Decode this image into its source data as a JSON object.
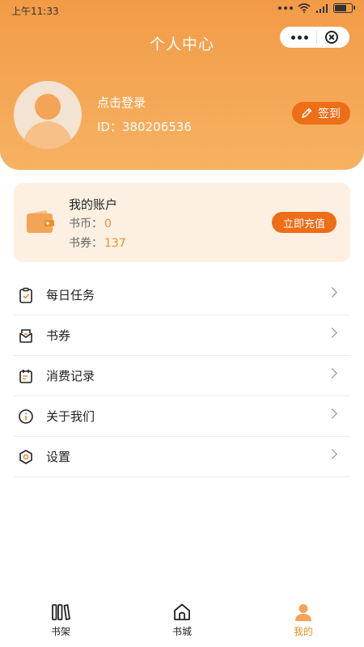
{
  "status": {
    "time": "上午11:33"
  },
  "header": {
    "title": "个人中心",
    "login_text": "点击登录",
    "user_id": "ID：380206536",
    "signin_label": "签到"
  },
  "account": {
    "title": "我的账户",
    "coins_label": "书币：",
    "coins_value": "0",
    "vouchers_label": "书券：",
    "vouchers_value": "137",
    "recharge_label": "立即充值"
  },
  "menu": {
    "items": [
      {
        "label": "每日任务",
        "icon": "clipboard-check-icon"
      },
      {
        "label": "书券",
        "icon": "ticket-icon"
      },
      {
        "label": "消费记录",
        "icon": "calendar-record-icon"
      },
      {
        "label": "关于我们",
        "icon": "info-icon"
      },
      {
        "label": "设置",
        "icon": "settings-icon"
      }
    ]
  },
  "nav": {
    "items": [
      {
        "label": "书架",
        "icon": "bookshelf-icon",
        "active": false
      },
      {
        "label": "书城",
        "icon": "home-icon",
        "active": false
      },
      {
        "label": "我的",
        "icon": "user-icon",
        "active": true
      }
    ]
  },
  "colors": {
    "accent": "#ee6d17",
    "header_top": "#f29b47",
    "header_bottom": "#f6b262",
    "card_bg": "#fdf0e2",
    "value_text": "#e8902b"
  }
}
